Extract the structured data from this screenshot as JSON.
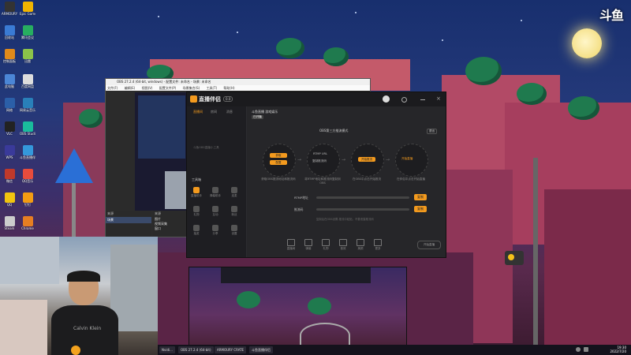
{
  "watermark": "斗鱼",
  "obs": {
    "title": "OBS 27.2.4 (64-bit, windows) - 配置文件: 未命名 - 场景: 未命名",
    "menu": [
      "文件(F)",
      "编辑(E)",
      "视图(V)",
      "配置文件(P)",
      "场景集合(S)",
      "工具(T)",
      "帮助(H)"
    ],
    "scenes_header": "来源",
    "scene_item": "场景",
    "sources_header": "来源",
    "sources": [
      "图片",
      "视频采集",
      "窗口"
    ]
  },
  "companion": {
    "app_name": "直播伴侣",
    "version": "0.0",
    "tabs": [
      "直播间",
      "房间",
      "消息"
    ],
    "room_title": "斗鱼直播 游戏娱乐",
    "status_tag": "已开播",
    "hint_text": "斗鱼OBS直播小工具",
    "mode_label": "OBS第三方推流模式",
    "mode_button": "退出",
    "steps": [
      {
        "label": "获取",
        "sub": "配置",
        "caption": "获取OBS推流地址和推流码"
      },
      {
        "label": "RTMP URL",
        "sub": "复制推流码",
        "caption": "将RTMP地址和推流码复制到OBS"
      },
      {
        "label": "开始推流",
        "sub": "",
        "caption": "在OBS中点击开始推流"
      },
      {
        "label": "开始直播",
        "sub": "",
        "caption": "在伴侣中点击开始直播"
      }
    ],
    "rtmp_label": "RTMP地址",
    "key_label": "推流码",
    "copy_btn": "复制",
    "copy_btn2": "复制",
    "note": "复制后在OBS设置-推流中粘贴，不要泄露推流码",
    "tools_header": "工具箱",
    "tools": [
      "直播助手",
      "弹幕助手",
      "连麦",
      "礼物",
      "互动",
      "粉丝",
      "抽奖",
      "分享",
      "设置"
    ],
    "bottom": [
      "直播间",
      "弹幕",
      "礼物",
      "音效",
      "美颜",
      "更多"
    ],
    "start_btn": "开始直播"
  },
  "taskbar": {
    "items": [
      "Nvidi...",
      "OBS 27.2.4 (64-bit)",
      "ARMOURY CRATE",
      "斗鱼直播伴侣"
    ],
    "time": "19:30",
    "date": "2022/7/20"
  },
  "desktop_icons": [
    "ARMOURY CRATE",
    "回收站",
    "控制面板",
    "此电脑",
    "网络",
    "VLC",
    "WPS",
    "微信",
    "QQ",
    "Steam",
    "Epic Games",
    "腾讯会议",
    "迅雷",
    "百度网盘",
    "网易云音乐",
    "OBS Studio",
    "斗鱼直播伴侣",
    "QQ音乐",
    "钉钉",
    "Chrome"
  ]
}
